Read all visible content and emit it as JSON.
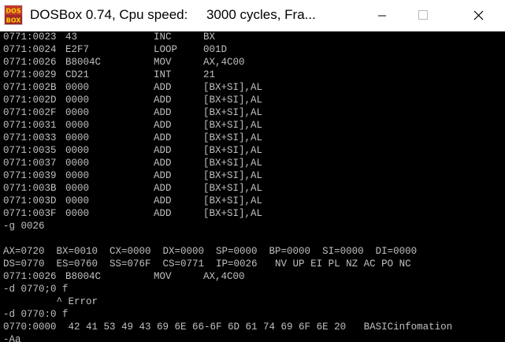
{
  "window": {
    "title": "DOSBox 0.74, Cpu speed:     3000 cycles, Fra...",
    "icon": "dosbox-icon",
    "icon_text_top": "DOS",
    "icon_text_bottom": "BOX",
    "controls": {
      "minimize": "minimize-icon",
      "maximize": "maximize-icon",
      "close": "close-icon"
    }
  },
  "colors": {
    "console_bg": "#000000",
    "console_text": "#c0c0c0",
    "titlebar_bg": "#ffffff"
  },
  "disasm_top": [
    {
      "addr": "0771:0023",
      "bytes": "43",
      "mnem": "INC",
      "ops": "BX"
    },
    {
      "addr": "0771:0024",
      "bytes": "E2F7",
      "mnem": "LOOP",
      "ops": "001D"
    },
    {
      "addr": "0771:0026",
      "bytes": "B8004C",
      "mnem": "MOV",
      "ops": "AX,4C00"
    },
    {
      "addr": "0771:0029",
      "bytes": "CD21",
      "mnem": "INT",
      "ops": "21"
    },
    {
      "addr": "0771:002B",
      "bytes": "0000",
      "mnem": "ADD",
      "ops": "[BX+SI],AL"
    },
    {
      "addr": "0771:002D",
      "bytes": "0000",
      "mnem": "ADD",
      "ops": "[BX+SI],AL"
    },
    {
      "addr": "0771:002F",
      "bytes": "0000",
      "mnem": "ADD",
      "ops": "[BX+SI],AL"
    },
    {
      "addr": "0771:0031",
      "bytes": "0000",
      "mnem": "ADD",
      "ops": "[BX+SI],AL"
    },
    {
      "addr": "0771:0033",
      "bytes": "0000",
      "mnem": "ADD",
      "ops": "[BX+SI],AL"
    },
    {
      "addr": "0771:0035",
      "bytes": "0000",
      "mnem": "ADD",
      "ops": "[BX+SI],AL"
    },
    {
      "addr": "0771:0037",
      "bytes": "0000",
      "mnem": "ADD",
      "ops": "[BX+SI],AL"
    },
    {
      "addr": "0771:0039",
      "bytes": "0000",
      "mnem": "ADD",
      "ops": "[BX+SI],AL"
    },
    {
      "addr": "0771:003B",
      "bytes": "0000",
      "mnem": "ADD",
      "ops": "[BX+SI],AL"
    },
    {
      "addr": "0771:003D",
      "bytes": "0000",
      "mnem": "ADD",
      "ops": "[BX+SI],AL"
    },
    {
      "addr": "0771:003F",
      "bytes": "0000",
      "mnem": "ADD",
      "ops": "[BX+SI],AL"
    }
  ],
  "cmd_go": "-g 0026",
  "blank": "",
  "regs_line1": "AX=0720  BX=0010  CX=0000  DX=0000  SP=0000  BP=0000  SI=0000  DI=0000",
  "regs_line2": "DS=0770  ES=0760  SS=076F  CS=0771  IP=0026   NV UP EI PL NZ AC PO NC",
  "disasm_current": {
    "addr": "0771:0026",
    "bytes": "B8004C",
    "mnem": "MOV",
    "ops": "AX,4C00"
  },
  "cmd_dump1": "-d 0770;0 f",
  "error_line": "         ^ Error",
  "cmd_dump2": "-d 0770:0 f",
  "dump_line": "0770:0000  42 41 53 49 43 69 6E 66-6F 6D 61 74 69 6F 6E 20   BASICinfomation",
  "prompt_partial": "-Aa"
}
